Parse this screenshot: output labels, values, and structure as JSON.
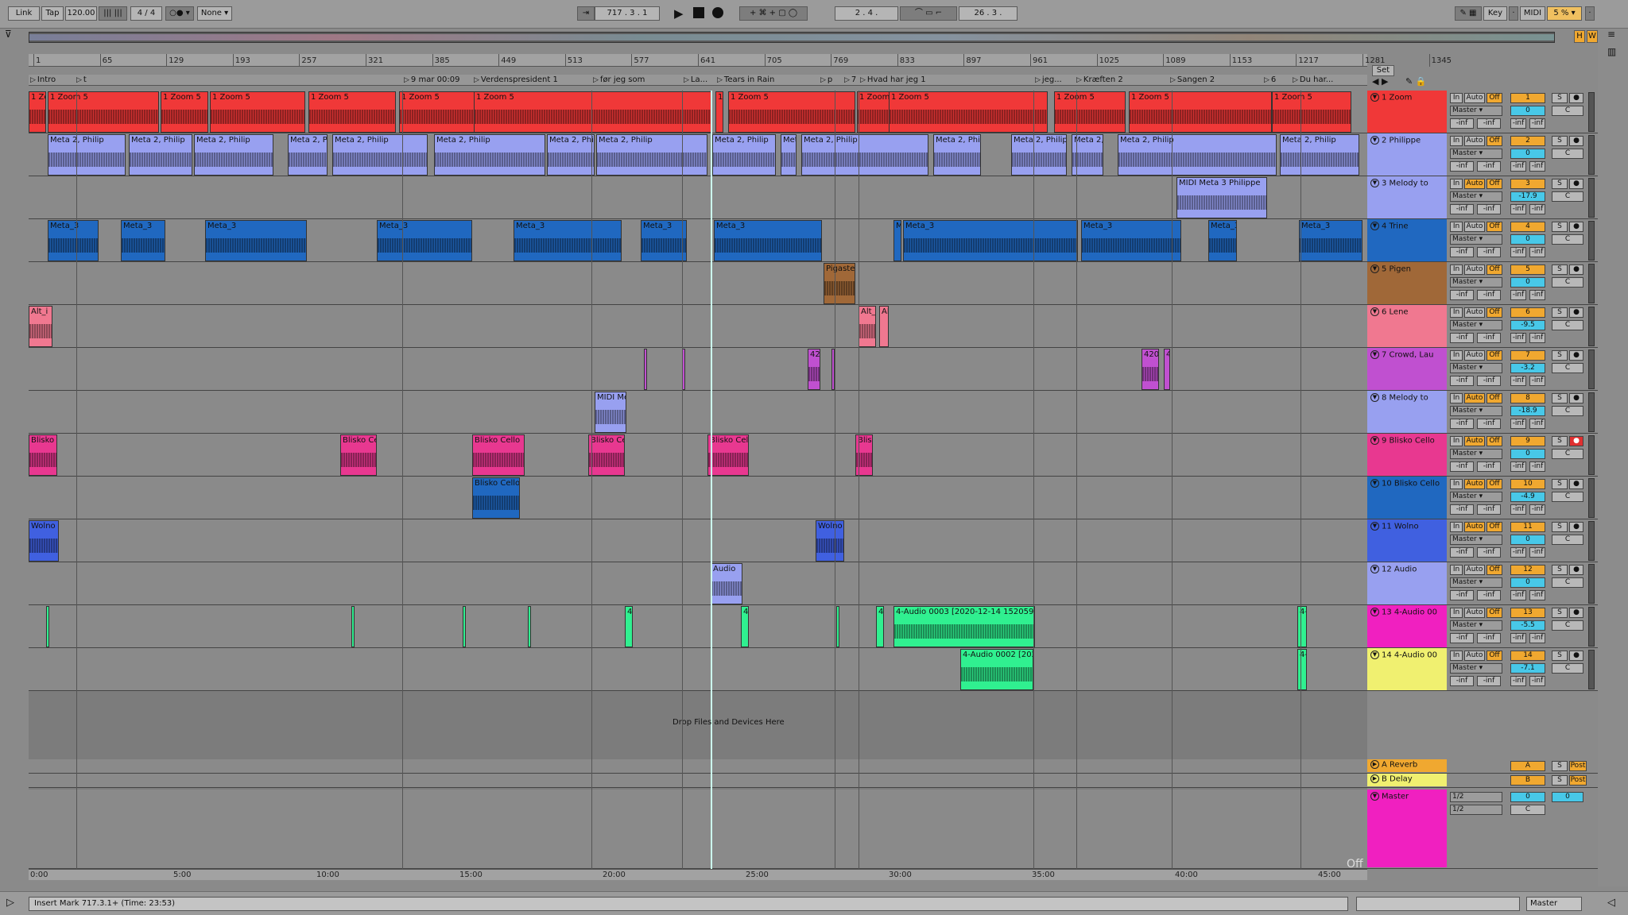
{
  "toolbar": {
    "link": "Link",
    "tap": "Tap",
    "tempo": "120.00",
    "signature": "4 / 4",
    "quantize": "None",
    "position": "717 .  3 .  1",
    "loop_start": "2 .  4 .",
    "loop_length": "26 .  3 .",
    "key": "Key",
    "midi": "MIDI",
    "cpu": "5 %",
    "h": "H",
    "w": "W"
  },
  "ruler": {
    "ticks": [
      "1",
      "65",
      "129",
      "193",
      "257",
      "321",
      "385",
      "449",
      "513",
      "577",
      "641",
      "705",
      "769",
      "833",
      "897",
      "961",
      "1025",
      "1089",
      "1153",
      "1217",
      "1281",
      "1345"
    ]
  },
  "locators": [
    {
      "label": "Intro"
    },
    {
      "label": "t"
    },
    {
      "label": "9 mar 00:09"
    },
    {
      "label": "Verdenspresident 1"
    },
    {
      "label": "før jeg som"
    },
    {
      "label": "La..."
    },
    {
      "label": "Tears in Rain"
    },
    {
      "label": "p"
    },
    {
      "label": "7"
    },
    {
      "label": "Hvad har jeg 1"
    },
    {
      "label": "jeg..."
    },
    {
      "label": "Kræften 2"
    },
    {
      "label": "Sangen 2"
    },
    {
      "label": "6"
    },
    {
      "label": "Du har..."
    }
  ],
  "tracks": [
    {
      "num": "1",
      "name": "1 Zoom",
      "color": "#f03838",
      "vol": "0",
      "pan": "C",
      "auto_on": false,
      "rec_on": false,
      "clip_label": "1 Zoom 5",
      "clip_color": "#f03838"
    },
    {
      "num": "2",
      "name": "2 Philippe",
      "color": "#98a0f0",
      "vol": "0",
      "pan": "C",
      "auto_on": false,
      "rec_on": false,
      "clip_label": "Meta 2, Philip",
      "clip_color": "#98a0f0"
    },
    {
      "num": "3",
      "name": "3 Melody to",
      "color": "#98a0f0",
      "vol": "-17.9",
      "pan": "C",
      "auto_on": true,
      "rec_on": false,
      "clip_label": "MIDI Meta 3 Philippe",
      "clip_color": "#98a0f0"
    },
    {
      "num": "4",
      "name": "4 Trine",
      "color": "#2068c0",
      "vol": "0",
      "pan": "C",
      "auto_on": false,
      "rec_on": false,
      "clip_label": "Meta_3",
      "clip_color": "#2068c0"
    },
    {
      "num": "5",
      "name": "5 Pigen",
      "color": "#a06838",
      "vol": "0",
      "pan": "C",
      "auto_on": false,
      "rec_on": false,
      "clip_label": "Pigaste",
      "clip_color": "#a06838"
    },
    {
      "num": "6",
      "name": "6 Lene",
      "color": "#f07890",
      "vol": "-9.5",
      "pan": "C",
      "auto_on": false,
      "rec_on": false,
      "clip_label": "Alt_i",
      "clip_color": "#f07890"
    },
    {
      "num": "7",
      "name": "7 Crowd, Lau",
      "color": "#c050d0",
      "vol": "-3.2",
      "pan": "C",
      "auto_on": false,
      "rec_on": false,
      "clip_label": "420",
      "clip_color": "#c050d0"
    },
    {
      "num": "8",
      "name": "8 Melody to",
      "color": "#98a0f0",
      "vol": "-18.9",
      "pan": "C",
      "auto_on": true,
      "rec_on": false,
      "clip_label": "MIDI Me",
      "clip_color": "#98a0f0"
    },
    {
      "num": "9",
      "name": "9 Blisko Cello",
      "color": "#e83890",
      "vol": "0",
      "pan": "C",
      "auto_on": true,
      "rec_on": true,
      "clip_label": "Blisko Cello",
      "clip_color": "#e83890"
    },
    {
      "num": "10",
      "name": "10 Blisko Cello",
      "color": "#2068c0",
      "vol": "-4.9",
      "pan": "C",
      "auto_on": true,
      "rec_on": false,
      "clip_label": "Blisko Cello",
      "clip_color": "#2068c0"
    },
    {
      "num": "11",
      "name": "11 Wolno",
      "color": "#4060e0",
      "vol": "0",
      "pan": "C",
      "auto_on": true,
      "rec_on": false,
      "clip_label": "Wolno",
      "clip_color": "#4060e0"
    },
    {
      "num": "12",
      "name": "12 Audio",
      "color": "#98a0f0",
      "vol": "0",
      "pan": "C",
      "auto_on": false,
      "rec_on": false,
      "clip_label": "Audio",
      "clip_color": "#98a0f0"
    },
    {
      "num": "13",
      "name": "13 4-Audio 00",
      "color": "#f020c0",
      "vol": "-5.5",
      "pan": "C",
      "auto_on": false,
      "rec_on": false,
      "clip_label": "4-Audio 0003 [2020-12-14 152059]",
      "clip_color": "#30f090"
    },
    {
      "num": "14",
      "name": "14 4-Audio 00",
      "color": "#f0f070",
      "vol": "-7.1",
      "pan": "C",
      "auto_on": false,
      "rec_on": false,
      "clip_label": "4-Audio 0002 [2020",
      "clip_color": "#30f090"
    }
  ],
  "track_common": {
    "in": "In",
    "auto": "Auto",
    "off": "Off",
    "out": "Master",
    "inf": "-inf",
    "solo": "S"
  },
  "returns": [
    {
      "name": "A Reverb",
      "letter": "A",
      "color": "#f0a830",
      "post": "Post"
    },
    {
      "name": "B Delay",
      "letter": "B",
      "color": "#f0f070",
      "post": "Post"
    }
  ],
  "master": {
    "name": "Master",
    "color": "#f020c0",
    "vol": "0",
    "split1": "1/2",
    "split2": "1/2",
    "pan": "C",
    "num": "0"
  },
  "drop_hint": "Drop Files and Devices Here",
  "off_label": "Off",
  "timeline": [
    "0:00",
    "5:00",
    "10:00",
    "15:00",
    "20:00",
    "25:00",
    "30:00",
    "35:00",
    "40:00",
    "45:00"
  ],
  "status": {
    "text": "Insert Mark 717.3.1+ (Time: 23:53)",
    "master_label": "Master"
  },
  "set_label": "Set"
}
